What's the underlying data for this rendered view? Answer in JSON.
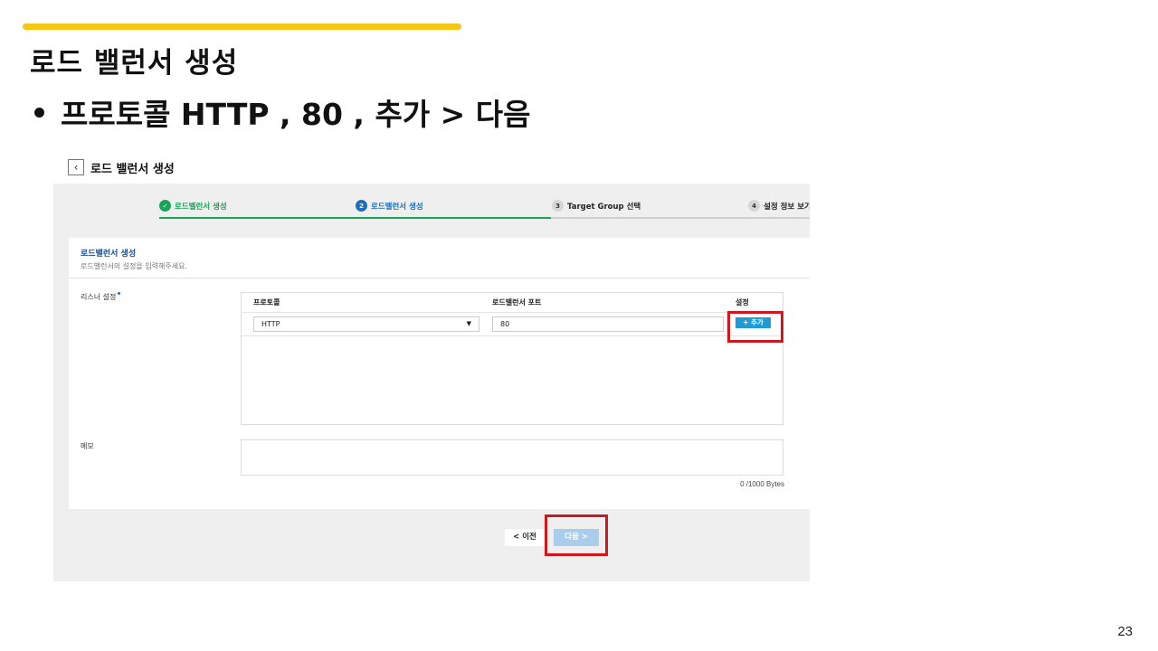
{
  "slide": {
    "title": "로드 밸런서 생성",
    "bullet": "프로토콜 HTTP , 80 , 추가 > 다음",
    "page_number": "23",
    "accent_color": "#f5c518"
  },
  "screenshot": {
    "header": {
      "back_icon": "chevron-left-icon",
      "title": "로드 밸런서 생성"
    },
    "stepper": [
      {
        "number": "1",
        "label": "로드밸런서 생성",
        "state": "done"
      },
      {
        "number": "2",
        "label": "로드밸런서 생성",
        "state": "active"
      },
      {
        "number": "3",
        "label": "Target Group 선택",
        "state": "todo"
      },
      {
        "number": "4",
        "label": "설정 정보 보기",
        "state": "todo"
      }
    ],
    "panel": {
      "title": "로드밸런서 생성",
      "subtitle": "로드밸런서의 설정을 입력해주세요.",
      "listener_label": "리스너 설정",
      "listener": {
        "col_protocol": "프로토콜",
        "col_port": "로드밸런서 포트",
        "col_setting": "설정",
        "protocol_value": "HTTP",
        "port_value": "80",
        "add_label": "+ 추가"
      },
      "memo_label": "메모",
      "bytes_counter": "0 /1000 Bytes"
    },
    "footer": {
      "prev_label": "< 이전",
      "next_label": "다음 >"
    },
    "colors": {
      "done": "#1aa35a",
      "active": "#1f6fb5",
      "add_button": "#1e9bd7",
      "highlight": "#d0161e"
    }
  }
}
